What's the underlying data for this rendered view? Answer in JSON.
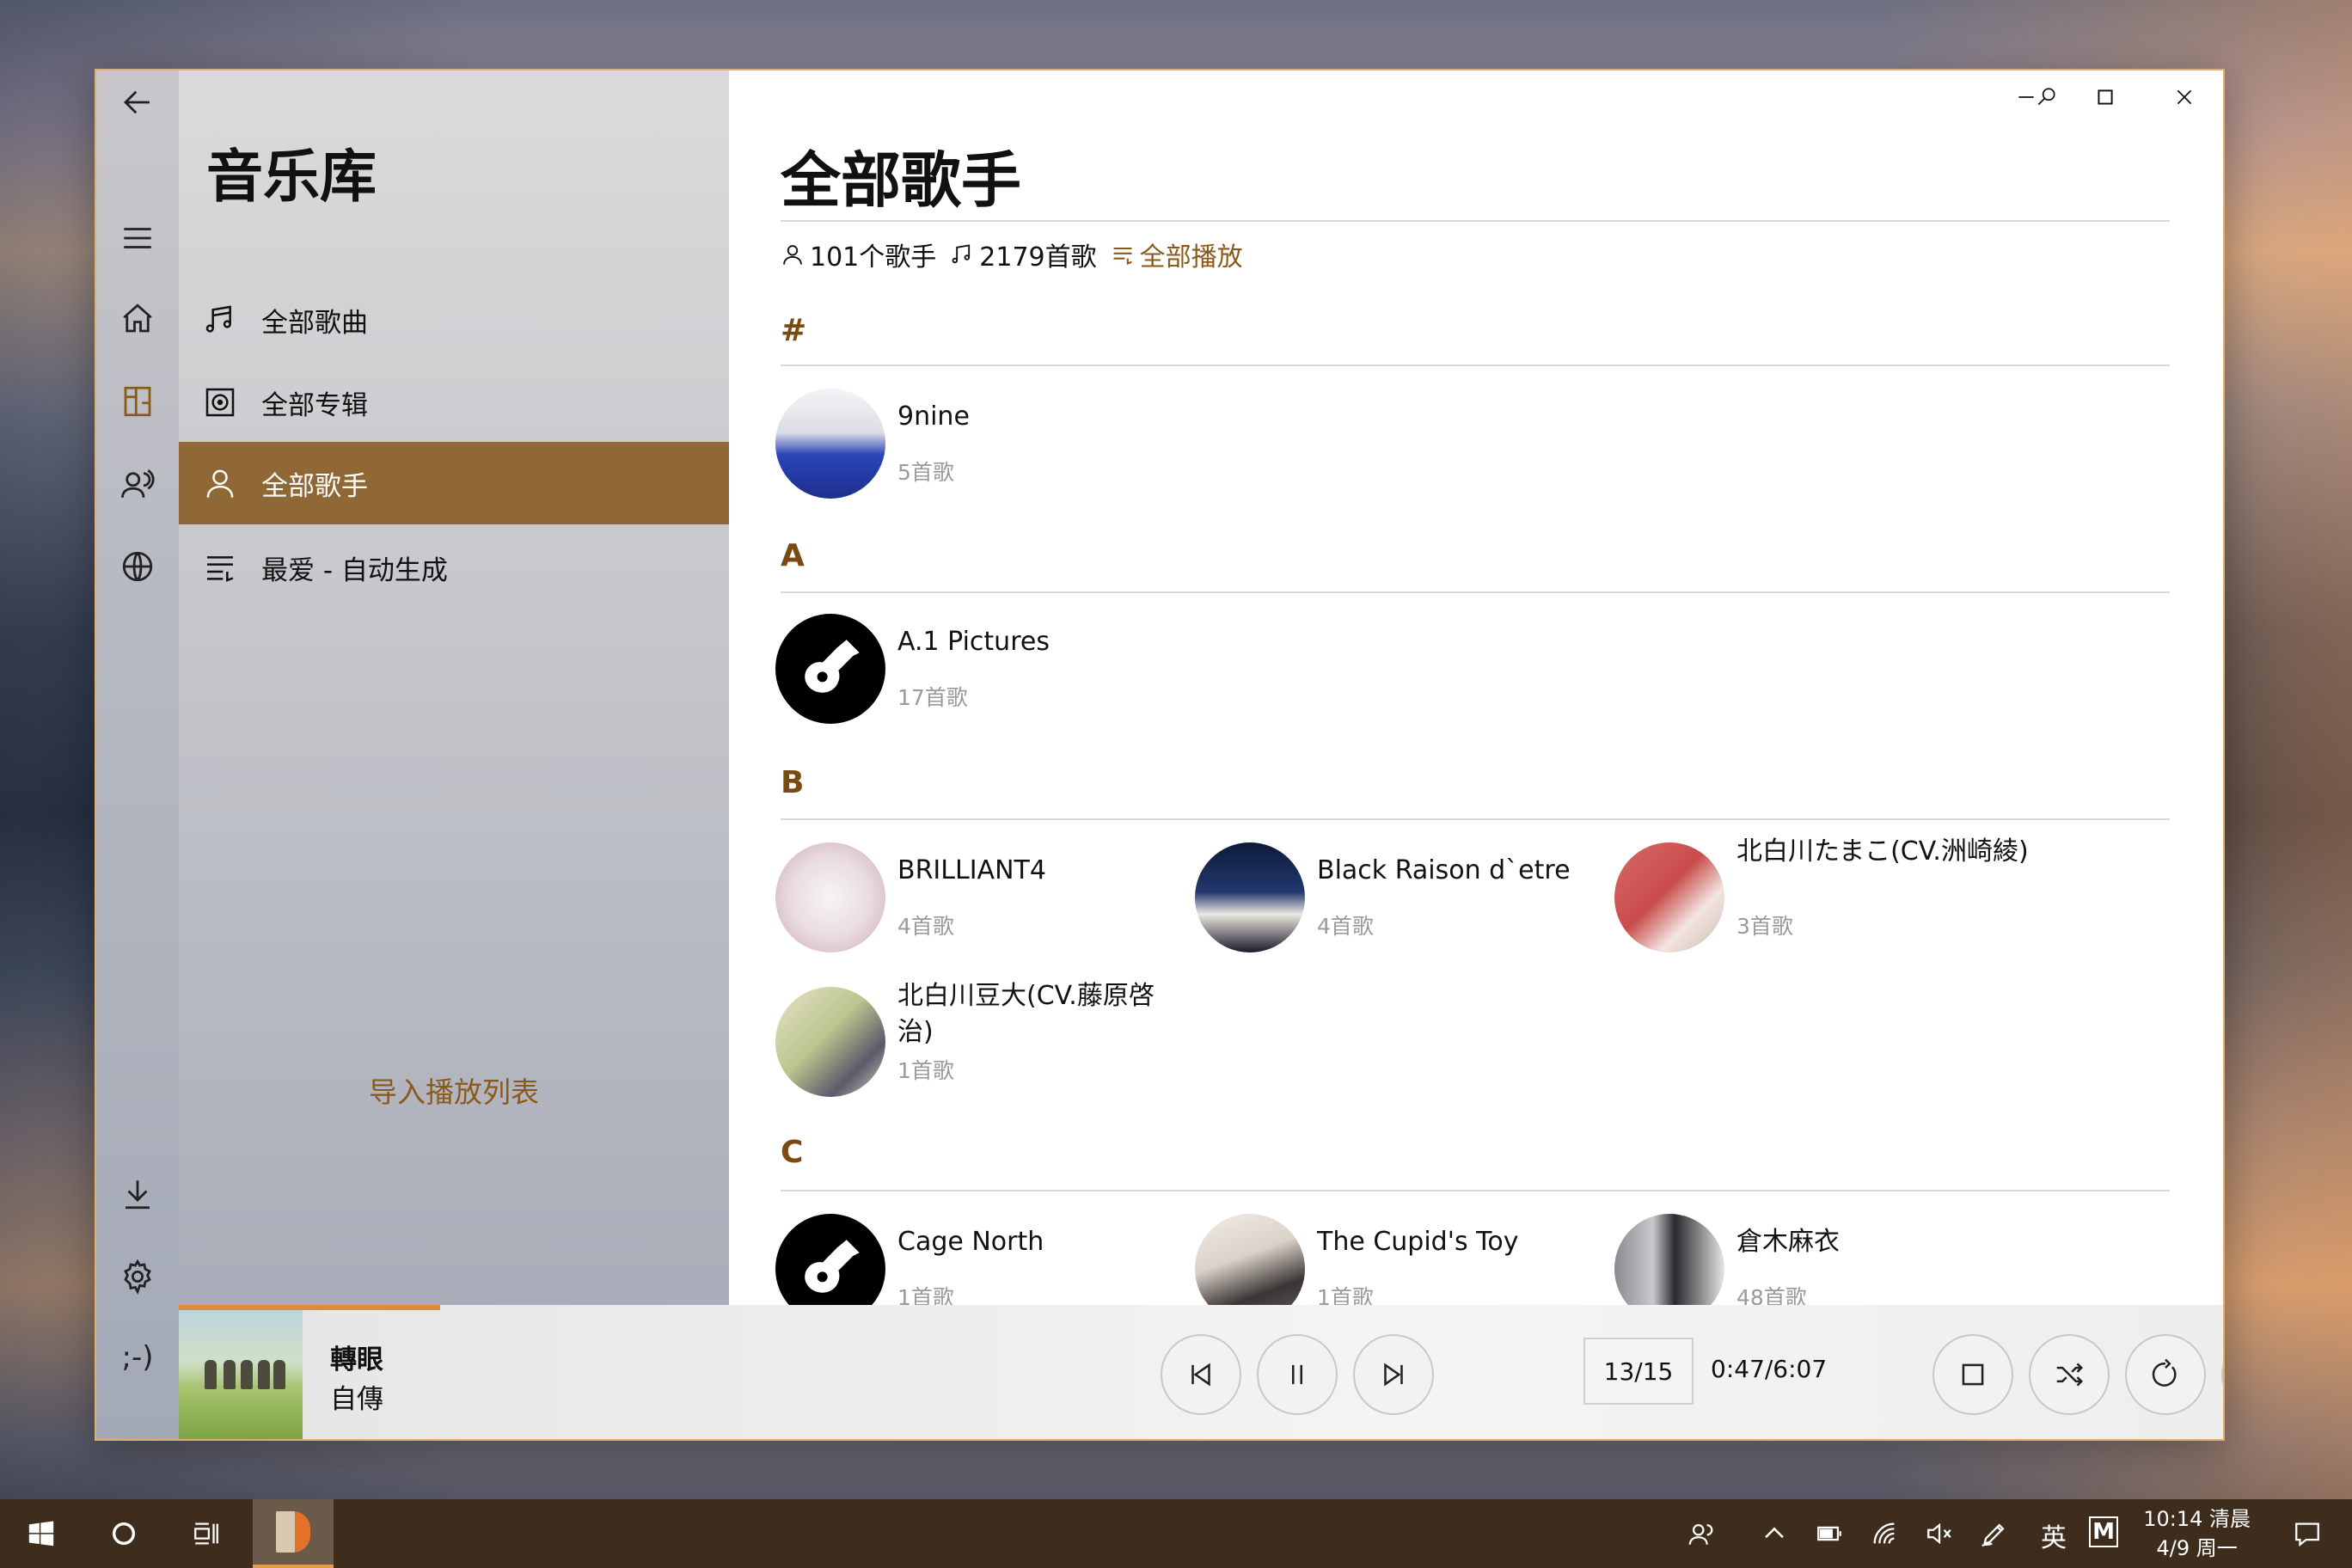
{
  "nav": {
    "title": "音乐库",
    "items": [
      {
        "label": "全部歌曲",
        "icon": "music-notes-icon"
      },
      {
        "label": "全部专辑",
        "icon": "album-icon"
      },
      {
        "label": "全部歌手",
        "icon": "person-icon",
        "active": true
      },
      {
        "label": "最爱 - 自动生成",
        "icon": "playlist-icon"
      }
    ],
    "import_label": "导入播放列表"
  },
  "main": {
    "title": "全部歌手",
    "stats": {
      "artists": "101个歌手",
      "songs": "2179首歌",
      "play_all": "全部播放"
    },
    "sections": [
      {
        "letter": "#",
        "artists": [
          {
            "name": "9nine",
            "count": "5首歌"
          }
        ]
      },
      {
        "letter": "A",
        "artists": [
          {
            "name": "A.1 Pictures",
            "count": "17首歌"
          }
        ]
      },
      {
        "letter": "B",
        "artists": [
          {
            "name": "BRILLIANT4",
            "count": "4首歌"
          },
          {
            "name": "Black Raison d`etre",
            "count": "4首歌"
          },
          {
            "name": "北白川たまこ(CV.洲崎綾)",
            "count": "3首歌"
          },
          {
            "name": "北白川豆大(CV.藤原啓治)",
            "count": "1首歌"
          }
        ]
      },
      {
        "letter": "C",
        "artists": [
          {
            "name": "Cage North",
            "count": "1首歌"
          },
          {
            "name": "The Cupid's Toy",
            "count": "1首歌"
          },
          {
            "name": "倉木麻衣",
            "count": "48首歌"
          }
        ]
      }
    ]
  },
  "player": {
    "song_title": "轉眼",
    "song_artist": "自傳",
    "track_counter": "13/15",
    "time": "0:47/6:07",
    "progress": 0.128
  },
  "taskbar": {
    "ime_lang": "英",
    "ime_mode": "M",
    "clock_time": "10:14 清晨",
    "clock_date": "4/9 周一"
  },
  "colors": {
    "accent": "#8f6836",
    "accent_text": "#8a5a1c",
    "progress": "#e08a3a"
  }
}
